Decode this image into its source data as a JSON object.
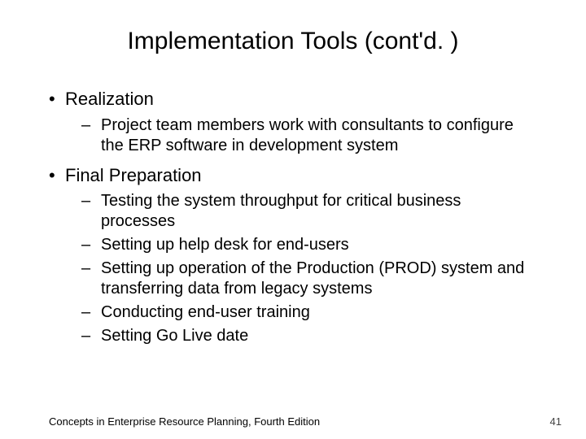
{
  "title": "Implementation Tools (cont'd. )",
  "b1": {
    "title": "Realization"
  },
  "b1_subs": {
    "s0": "Project team members work with consultants to configure the ERP software in development system"
  },
  "b2": {
    "title": "Final Preparation"
  },
  "b2_subs": {
    "s0": "Testing the system throughput for critical business processes",
    "s1": "Setting up help desk for end-users",
    "s2": "Setting up operation of the Production (PROD) system and transferring data from legacy systems",
    "s3": "Conducting end-user training",
    "s4": "Setting Go Live date"
  },
  "footer": {
    "text": "Concepts in Enterprise Resource Planning, Fourth Edition",
    "page": "41"
  },
  "glyphs": {
    "bullet": "•",
    "dash": "–"
  }
}
